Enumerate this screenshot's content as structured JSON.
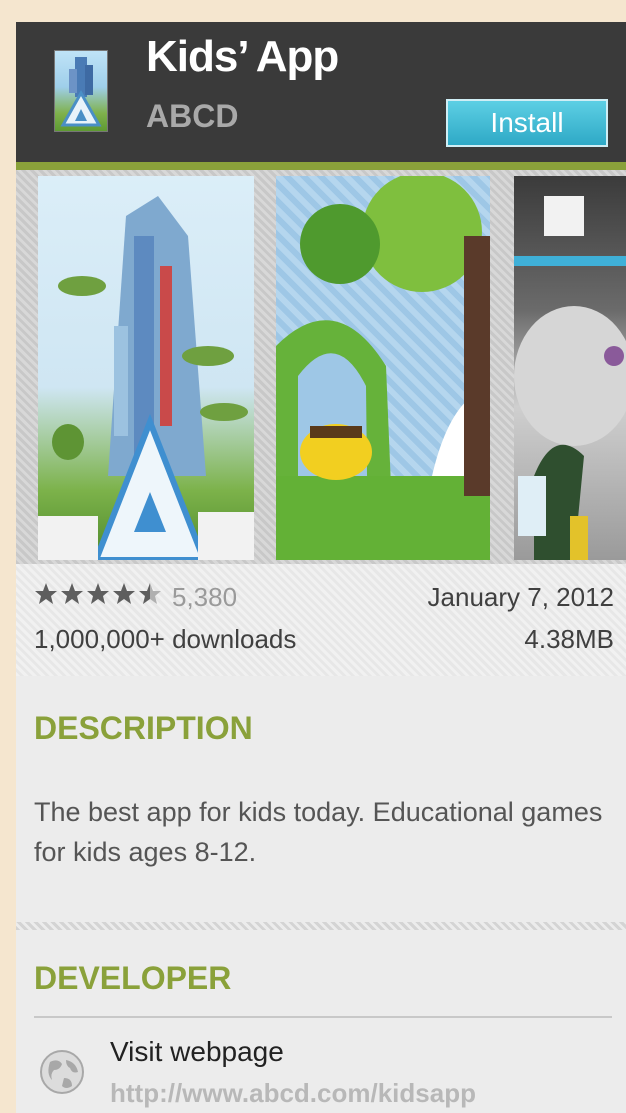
{
  "app": {
    "title": "Kids’ App",
    "developer": "ABCD",
    "install_label": "Install",
    "icon": "app-icon"
  },
  "screenshots": [
    {
      "icon": "screenshot-tower-city"
    },
    {
      "icon": "screenshot-green-trees"
    },
    {
      "icon": "screenshot-indoor-scene"
    }
  ],
  "stats": {
    "stars": "★★★★★",
    "rating_value": 4.5,
    "rating_count": "5,380",
    "release_date": "January 7, 2012",
    "downloads": "1,000,000+ downloads",
    "file_size": "4.38MB"
  },
  "description": {
    "heading": "DESCRIPTION",
    "text": "The best app for kids today. Educational games for kids ages 8-12."
  },
  "developer_section": {
    "heading": "DEVELOPER",
    "visit_label": "Visit webpage",
    "url": "http://www.abcd.com/kidsapp",
    "icon": "globe-icon"
  },
  "colors": {
    "accent": "#8aa13a",
    "header_bg": "#3a3a3a",
    "install_button": "#2ea9c6",
    "background": "#f5e6cf"
  }
}
